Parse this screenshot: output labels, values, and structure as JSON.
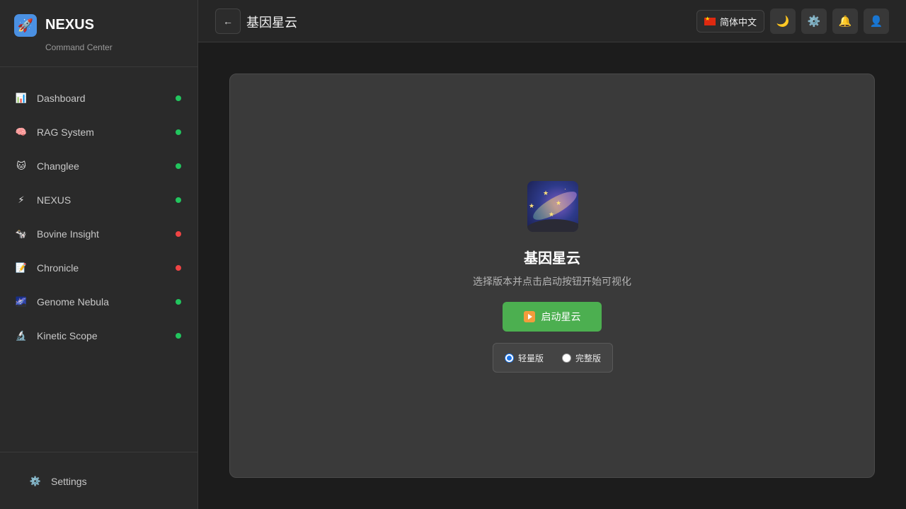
{
  "brand": {
    "name": "NEXUS",
    "subtitle": "Command Center",
    "logo_icon": "🚀"
  },
  "sidebar": {
    "items": [
      {
        "label": "Dashboard",
        "icon": "📊",
        "icon_name": "chart-icon",
        "status_color": "#22c55e"
      },
      {
        "label": "RAG System",
        "icon": "🧠",
        "icon_name": "brain-icon",
        "status_color": "#22c55e"
      },
      {
        "label": "Changlee",
        "icon": "🐱",
        "icon_name": "cat-icon",
        "status_color": "#22c55e"
      },
      {
        "label": "NEXUS",
        "icon": "⚡",
        "icon_name": "lightning-icon",
        "status_color": "#22c55e"
      },
      {
        "label": "Bovine Insight",
        "icon": "🐄",
        "icon_name": "cow-icon",
        "status_color": "#ef4444"
      },
      {
        "label": "Chronicle",
        "icon": "📝",
        "icon_name": "memo-icon",
        "status_color": "#ef4444"
      },
      {
        "label": "Genome Nebula",
        "icon": "🌌",
        "icon_name": "galaxy-icon",
        "status_color": "#22c55e"
      },
      {
        "label": "Kinetic Scope",
        "icon": "🔬",
        "icon_name": "microscope-icon",
        "status_color": "#22c55e"
      }
    ],
    "footer": {
      "label": "Settings",
      "icon": "⚙️"
    }
  },
  "header": {
    "back_icon": "←",
    "title": "基因星云",
    "language": "简体中文",
    "theme_icon": "🌙",
    "settings_icon": "⚙️",
    "notification_icon": "🔔",
    "user_icon": "👤"
  },
  "main": {
    "title": "基因星云",
    "description": "选择版本并点击启动按钮开始可视化",
    "launch_label": "启动星云",
    "versions": [
      {
        "label": "轻量版",
        "selected": true
      },
      {
        "label": "完整版",
        "selected": false
      }
    ]
  }
}
